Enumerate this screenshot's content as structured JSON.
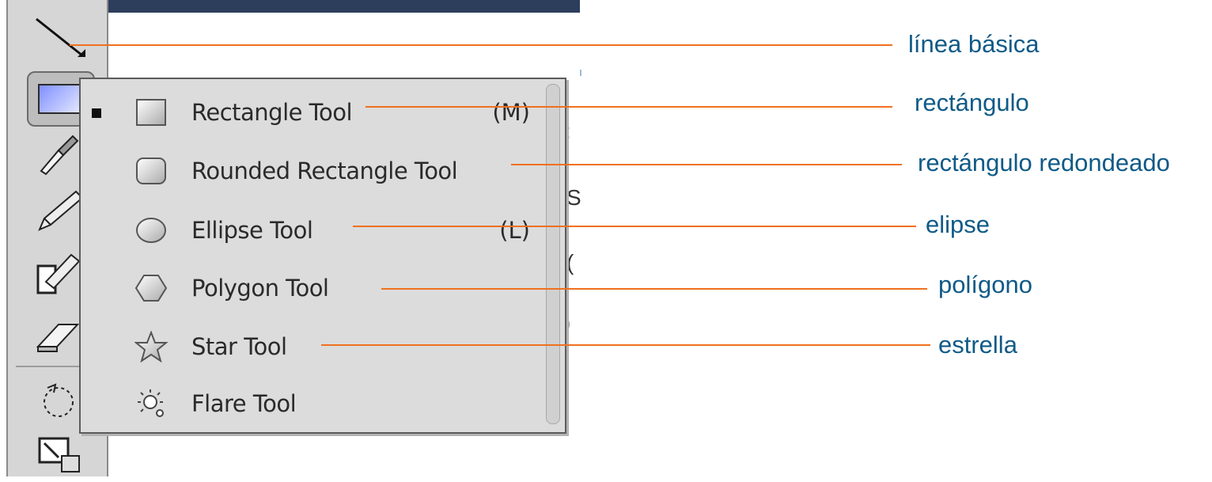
{
  "menu": {
    "items": [
      {
        "label": "Rectangle Tool",
        "shortcut": "(M)",
        "icon": "rectangle-icon",
        "checked": true
      },
      {
        "label": "Rounded Rectangle Tool",
        "shortcut": "",
        "icon": "rounded-rectangle-icon",
        "checked": false
      },
      {
        "label": "Ellipse Tool",
        "shortcut": "(L)",
        "icon": "ellipse-icon",
        "checked": false
      },
      {
        "label": "Polygon Tool",
        "shortcut": "",
        "icon": "polygon-icon",
        "checked": false
      },
      {
        "label": "Star Tool",
        "shortcut": "",
        "icon": "star-icon",
        "checked": false
      },
      {
        "label": "Flare Tool",
        "shortcut": "",
        "icon": "flare-icon",
        "checked": false
      }
    ]
  },
  "toolbar": {
    "tools": [
      "line-segment-icon",
      "rectangle-icon",
      "paintbrush-icon",
      "pencil-icon",
      "blob-brush-icon",
      "eraser-icon",
      "rotate-icon",
      "scale-icon"
    ]
  },
  "callouts": [
    {
      "label": "línea básica"
    },
    {
      "label": "rectángulo"
    },
    {
      "label": "rectángulo redondeado"
    },
    {
      "label": "elipse"
    },
    {
      "label": "polígono"
    },
    {
      "label": "estrella"
    }
  ],
  "colors": {
    "callout_line": "#f07020",
    "callout_text": "#0f5a87",
    "menu_background": "#dcdcdc",
    "top_band": "#2c3e5c"
  }
}
